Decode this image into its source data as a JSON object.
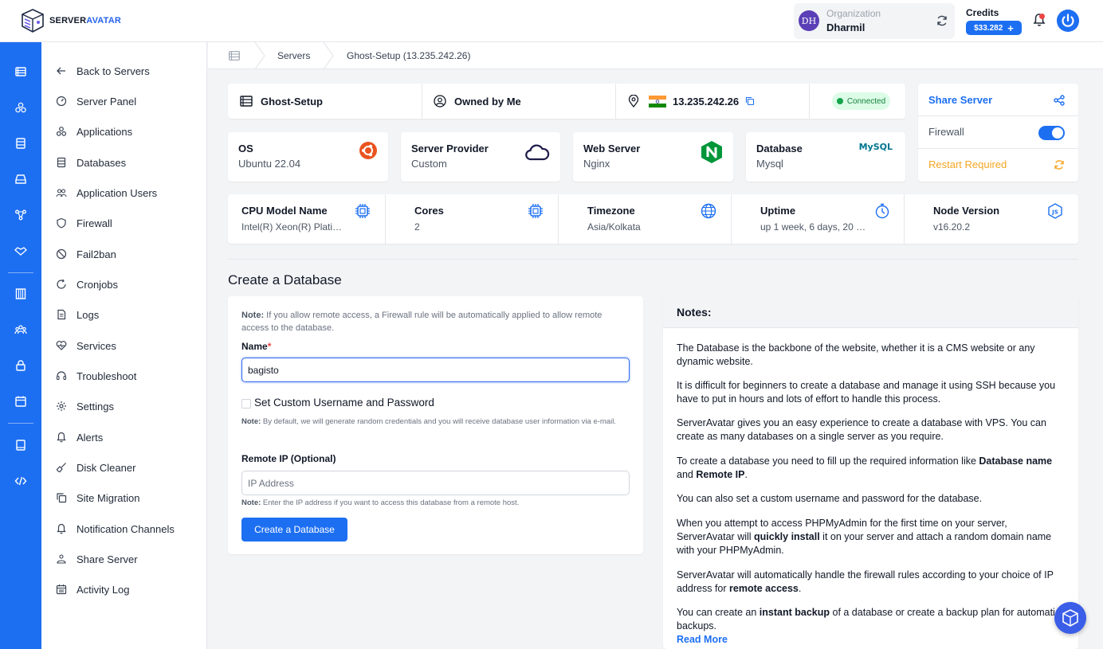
{
  "brand": {
    "name_part1": "SERVER",
    "name_part2": "AVATAR"
  },
  "topbar": {
    "org_initials": "DH",
    "org_label": "Organization",
    "org_name": "Dharmil",
    "credits_label": "Credits",
    "credits_value": "$33.282",
    "credits_plus": "+"
  },
  "breadcrumb": {
    "item1": "Servers",
    "item2": "Ghost-Setup (13.235.242.26)"
  },
  "sidebar": {
    "items": [
      {
        "label": "Back to Servers"
      },
      {
        "label": "Server Panel"
      },
      {
        "label": "Applications"
      },
      {
        "label": "Databases"
      },
      {
        "label": "Application Users"
      },
      {
        "label": "Firewall"
      },
      {
        "label": "Fail2ban"
      },
      {
        "label": "Cronjobs"
      },
      {
        "label": "Logs"
      },
      {
        "label": "Services"
      },
      {
        "label": "Troubleshoot"
      },
      {
        "label": "Settings"
      },
      {
        "label": "Alerts"
      },
      {
        "label": "Disk Cleaner"
      },
      {
        "label": "Site Migration"
      },
      {
        "label": "Notification Channels"
      },
      {
        "label": "Share Server"
      },
      {
        "label": "Activity Log"
      }
    ]
  },
  "server": {
    "name": "Ghost-Setup",
    "owner": "Owned by Me",
    "ip": "13.235.242.26",
    "status": "Connected",
    "status_color": "#16a34a"
  },
  "info_cards": [
    {
      "title": "OS",
      "value": "Ubuntu 22.04",
      "icon": "ubuntu-icon"
    },
    {
      "title": "Server Provider",
      "value": "Custom",
      "icon": "cloud-icon"
    },
    {
      "title": "Web Server",
      "value": "Nginx",
      "icon": "nginx-icon"
    },
    {
      "title": "Database",
      "value": "Mysql",
      "icon": "mysql-logo",
      "logo_text": "MySQL"
    }
  ],
  "right_panel": {
    "share_label": "Share Server",
    "firewall_label": "Firewall",
    "firewall_on": true,
    "restart_label": "Restart Required"
  },
  "metrics": [
    {
      "title": "CPU Model Name",
      "value": "Intel(R) Xeon(R) Platin...",
      "icon": "cpu-icon"
    },
    {
      "title": "Cores",
      "value": "2",
      "icon": "cpu-icon"
    },
    {
      "title": "Timezone",
      "value": "Asia/Kolkata",
      "icon": "globe-icon"
    },
    {
      "title": "Uptime",
      "value": "up 1 week, 6 days, 20 h...",
      "icon": "timer-icon"
    },
    {
      "title": "Node Version",
      "value": "v16.20.2",
      "icon": "nodejs-icon"
    }
  ],
  "form": {
    "section_title": "Create a Database",
    "note_bold": "Note:",
    "note_text": " If you allow remote access, a Firewall rule will be automatically applied to allow remote access to the database.",
    "name_label": "Name",
    "name_required": "*",
    "name_value": "bagisto",
    "custom_cred_label": "Set Custom Username and Password",
    "custom_cred_checked": false,
    "cred_note_bold": "Note:",
    "cred_note_text": " By default, we will generate random credentials and you will receive database user information via e-mail.",
    "remote_label": "Remote IP (Optional)",
    "remote_placeholder": "IP Address",
    "remote_note_bold": "Note:",
    "remote_note_text": " Enter the IP address if you want to access this database from a remote host.",
    "submit_label": "Create a Database"
  },
  "notes": {
    "title": "Notes:",
    "p1": "The Database is the backbone of the website, whether it is a CMS website or any dynamic website.",
    "p2": "It is difficult for beginners to create a database and manage it using SSH because you have to put in hours and lots of effort to handle this process.",
    "p3": "ServerAvatar gives you an easy experience to create a database with VPS. You can create as many databases on a single server as you require.",
    "p4_a": "To create a database you need to fill up the required information like ",
    "p4_b": "Database name",
    "p4_c": " and ",
    "p4_d": "Remote IP",
    "p4_e": ".",
    "p5": "You can also set a custom username and password for the database.",
    "p6_a": "When you attempt to access PHPMyAdmin for the first time on your server, ServerAvatar will ",
    "p6_b": "quickly install",
    "p6_c": " it on your server and attach a random domain name with your PHPMyAdmin.",
    "p7_a": "ServerAvatar will automatically handle the firewall rules according to your choice of IP address for ",
    "p7_b": "remote access",
    "p7_c": ".",
    "p8_a": "You can create an ",
    "p8_b": "instant backup",
    "p8_c": " of a database or create a backup plan for automatic backups.",
    "read_more": "Read More"
  },
  "colors": {
    "primary": "#1d6ff2",
    "warning": "#f5a623",
    "success": "#16a34a"
  }
}
